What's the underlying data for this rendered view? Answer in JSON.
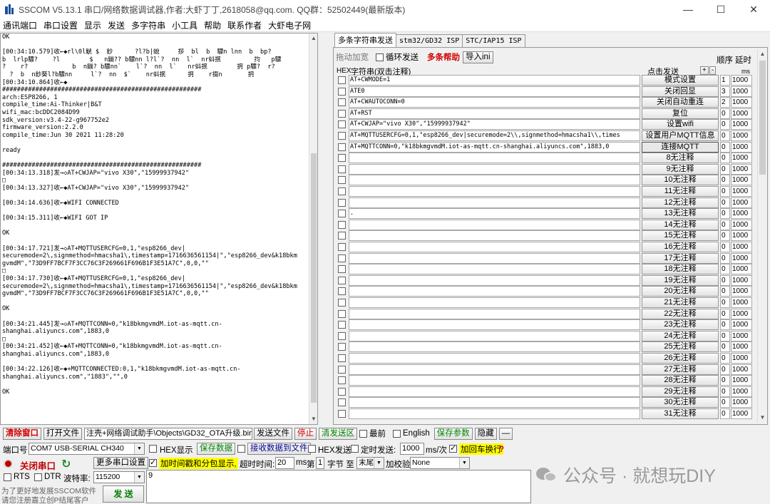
{
  "window": {
    "title": "SSCOM V5.13.1 串口/网络数据调试器,作者:大虾丁丁,2618058@qq.com. QQ群：52502449(最新版本)",
    "minimize": "—",
    "maximize": "☐",
    "close": "✕"
  },
  "menu": [
    "通讯端口",
    "串口设置",
    "显示",
    "发送",
    "多字符串",
    "小工具",
    "帮助",
    "联系作者",
    "大虾电子网"
  ],
  "receive": {
    "text": "OK\n\n[00:34:10.579]收←◆rl\\0l觥 $  鈔      ?l?b|蛻     拶  bl  b  驃n lnn  b  bp?\nb  lrlp驃?    ?l        $   n鏰?? b驃nn l?l`?  nn  l`  nr蚪抿         抣   p驃\n?    r?            b  n鏰? b驃nn`    l`?  nn  l`   nr蚪抿        抈 p驃?  r?\n  ?  b  n鈔葵l?b驃nn     l`?  nn  $`    nr蚪抿      抈    r掇n       抈\n[00:34:10.864]收←◆\n######################################################\narch:ESP8266, 1\ncompile_time:Ai-Thinker|B&T\nwifi_mac:bcDDC2084D99\nsdk_version:v3.4-22-g967752e2\nfirmware_version:2.2.0\ncompile_time:Jun 30 2021 11:28:20\n\nready\n\n######################################################\n[00:34:13.318]发→◇AT+CWJAP=\"vivo X30\",\"15999937942\"\n□\n[00:34:13.327]收←◆AT+CWJAP=\"vivo X30\",\"15999937942\"\n\n[00:34:14.636]收←◆WIFI CONNECTED\n\n[00:34:15.311]收←◆WIFI GOT IP\n\nOK\n\n[00:34:17.721]发→◇AT+MQTTUSERCFG=0,1,\"esp8266_dev|\nsecuremode=2\\,signmethod=hmacsha1\\,timestamp=1716636561154|\",\"esp8266_dev&k18bkm\ngvmdM\",\"73D9FF7BCF7F3CC76C3F269661F696B1F3E51A7C\",0,0,\"\"\n□\n[00:34:17.730]收←◆AT+MQTTUSERCFG=0,1,\"esp8266_dev|\nsecuremode=2\\,signmethod=hmacsha1\\,timestamp=1716636561154|\",\"esp8266_dev&k18bkm\ngvmdM\",\"73D9FF7BCF7F3CC76C3F269661F696B1F3E51A7C\",0,0,\"\"\n\nOK\n\n[00:34:21.445]发→◇AT+MQTTCONN=0,\"k18bkmgvmdM.iot-as-mqtt.cn-\nshanghai.aliyuncs.com\",1883,0\n□\n[00:34:21.452]收←◆AT+MQTTCONN=0,\"k18bkmgvmdM.iot-as-mqtt.cn-\nshanghai.aliyuncs.com\",1883,0\n\n[00:34:22.126]收←◆+MQTTCONNECTED:0,1,\"k18bkmgvmdM.iot-as-mqtt.cn-\nshanghai.aliyuncs.com\",\"1883\",\"\",0\n\nOK"
  },
  "tabs": [
    "多条字符串发送",
    "stm32/GD32 ISP",
    "STC/IAP15 ISP"
  ],
  "multi": {
    "drag_label": "拖动加宽",
    "loop_label": "循环发送",
    "help_button": "多条帮助",
    "import_button": "导入ini",
    "order_header": "顺序",
    "delay_header": "延时",
    "hex_header": "HEX",
    "string_header": "字符串(双击注释)",
    "click_send_header": "点击发送",
    "plus": "+",
    "minus": "-",
    "ms_header": "ms",
    "rows": [
      {
        "cmd": "AT+CWMODE=1",
        "label": "模式设置",
        "order": "1",
        "delay": "1000"
      },
      {
        "cmd": "ATE0",
        "label": "关闭回显",
        "order": "3",
        "delay": "1000"
      },
      {
        "cmd": "AT+CWAUTOCONN=0",
        "label": "关闭自动重连",
        "order": "2",
        "delay": "1000"
      },
      {
        "cmd": "AT+RST",
        "label": "复位",
        "order": "0",
        "delay": "1000"
      },
      {
        "cmd": "AT+CWJAP=\"vivo X30\",\"15999937942\"",
        "label": "设置wifi",
        "order": "0",
        "delay": "1000"
      },
      {
        "cmd": "AT+MQTTUSERCFG=0,1,\"esp8266_dev|securemode=2\\\\,signmethod=hmacsha1\\\\,times",
        "label": "设置用户MQTT信息",
        "order": "0",
        "delay": "1000"
      },
      {
        "cmd": "AT+MQTTCONN=0,\"k18bkmgvmdM.iot-as-mqtt.cn-shanghai.aliyuncs.com\",1883,0",
        "label": "连接MQTT",
        "order": "0",
        "delay": "1000"
      },
      {
        "cmd": "",
        "label": "8无注释",
        "order": "0",
        "delay": "1000"
      },
      {
        "cmd": "",
        "label": "9无注释",
        "order": "0",
        "delay": "1000"
      },
      {
        "cmd": "",
        "label": "10无注释",
        "order": "0",
        "delay": "1000"
      },
      {
        "cmd": "",
        "label": "11无注释",
        "order": "0",
        "delay": "1000"
      },
      {
        "cmd": "",
        "label": "12无注释",
        "order": "0",
        "delay": "1000"
      },
      {
        "cmd": ".",
        "label": "13无注释",
        "order": "0",
        "delay": "1000"
      },
      {
        "cmd": "",
        "label": "14无注释",
        "order": "0",
        "delay": "1000"
      },
      {
        "cmd": "",
        "label": "15无注释",
        "order": "0",
        "delay": "1000"
      },
      {
        "cmd": "",
        "label": "16无注释",
        "order": "0",
        "delay": "1000"
      },
      {
        "cmd": "",
        "label": "17无注释",
        "order": "0",
        "delay": "1000"
      },
      {
        "cmd": "",
        "label": "18无注释",
        "order": "0",
        "delay": "1000"
      },
      {
        "cmd": "",
        "label": "19无注释",
        "order": "0",
        "delay": "1000"
      },
      {
        "cmd": "",
        "label": "20无注释",
        "order": "0",
        "delay": "1000"
      },
      {
        "cmd": "",
        "label": "21无注释",
        "order": "0",
        "delay": "1000"
      },
      {
        "cmd": "",
        "label": "22无注释",
        "order": "0",
        "delay": "1000"
      },
      {
        "cmd": "",
        "label": "23无注释",
        "order": "0",
        "delay": "1000"
      },
      {
        "cmd": "",
        "label": "24无注释",
        "order": "0",
        "delay": "1000"
      },
      {
        "cmd": "",
        "label": "25无注释",
        "order": "0",
        "delay": "1000"
      },
      {
        "cmd": "",
        "label": "26无注释",
        "order": "0",
        "delay": "1000"
      },
      {
        "cmd": "",
        "label": "27无注释",
        "order": "0",
        "delay": "1000"
      },
      {
        "cmd": "",
        "label": "28无注释",
        "order": "0",
        "delay": "1000"
      },
      {
        "cmd": "",
        "label": "29无注释",
        "order": "0",
        "delay": "1000"
      },
      {
        "cmd": "",
        "label": "30无注释",
        "order": "0",
        "delay": "1000"
      },
      {
        "cmd": "",
        "label": "31无注释",
        "order": "0",
        "delay": "1000"
      }
    ]
  },
  "toolbar": {
    "clear_window": "清除窗口",
    "open_file": "打开文件",
    "file_path": "注壳+网络调试助手\\Objects\\GD32_OTA升级.bin",
    "send_file": "发送文件",
    "stop": "停止",
    "clear_send": "清发送区",
    "topmost": "最前",
    "english": "English",
    "save_params": "保存参数",
    "hide": "隐藏",
    "collapse": "—"
  },
  "bottom": {
    "port_label": "端口号",
    "port_value": "COM7 USB-SERIAL CH340",
    "hex_display": "HEX显示",
    "save_data": "保存数据",
    "recv_to_file": "接收数据到文件",
    "hex_send": "HEX发送",
    "timed_send": "定时发送:",
    "interval": "1000",
    "interval_unit": "ms/次",
    "add_crlf": "加回车换行",
    "close_port": "关闭串口",
    "more_settings": "更多串口设置",
    "add_timestamp": "加时间戳和分包显示,",
    "timeout_label": "超时时间:",
    "timeout_value": "20",
    "ms": "ms",
    "nth_label": "第",
    "nth_value": "1",
    "byte_to": "字节 至",
    "end_value": "末尾",
    "checksum_label": "加校验",
    "checksum_value": "None",
    "rts": "RTS",
    "dtr": "DTR",
    "baud_label": "波特率:",
    "baud_value": "115200",
    "send_text": "9",
    "promo_line1": "为了更好地发展SSCOM软件",
    "promo_line2": "请您注册嘉立创P结尾客户",
    "send_button": "发 送"
  },
  "watermark": "公众号 · 就想玩DIY"
}
